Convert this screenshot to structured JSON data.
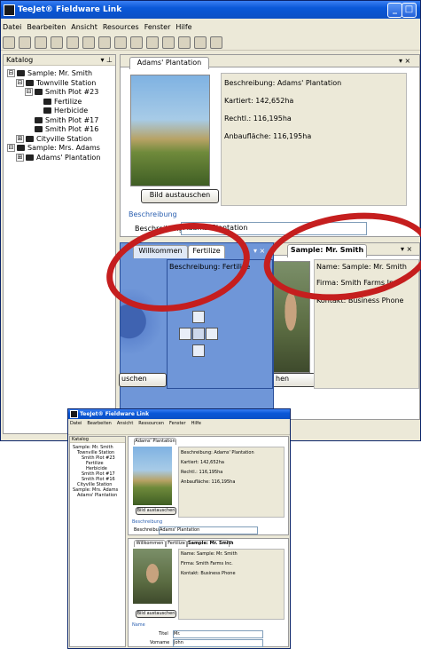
{
  "window": {
    "title": "TeeJet® Fieldware Link",
    "controls": [
      "_",
      "□",
      "×"
    ]
  },
  "menu": [
    "Datei",
    "Bearbeiten",
    "Ansicht",
    "Resources",
    "Fenster",
    "Hilfe"
  ],
  "catalog": {
    "title": "Katalog",
    "pin": "▾ ⊥",
    "items": [
      {
        "label": "Sample: Mr. Smith",
        "level": 0,
        "icon": "person-icon",
        "expander": "⊟"
      },
      {
        "label": "Townville Station",
        "level": 1,
        "icon": "station-icon",
        "expander": "⊟"
      },
      {
        "label": "Smith Plot #23",
        "level": 2,
        "icon": "field-icon",
        "expander": "⊟"
      },
      {
        "label": "Fertilize",
        "level": 3,
        "icon": "task-icon",
        "expander": ""
      },
      {
        "label": "Herbicide",
        "level": 3,
        "icon": "task-icon",
        "expander": ""
      },
      {
        "label": "Smith Plot #17",
        "level": 2,
        "icon": "field-icon",
        "expander": ""
      },
      {
        "label": "Smith Plot #16",
        "level": 2,
        "icon": "field-icon",
        "expander": ""
      },
      {
        "label": "Cityville Station",
        "level": 1,
        "icon": "station-icon",
        "expander": "⊞"
      },
      {
        "label": "Sample: Mrs. Adams",
        "level": 0,
        "icon": "person-icon",
        "expander": "⊟"
      },
      {
        "label": "Adams' Plantation",
        "level": 1,
        "icon": "station-icon",
        "expander": "⊞"
      }
    ]
  },
  "top_doc": {
    "tab": "Adams' Plantation",
    "close": "▾ ×",
    "details": [
      "Beschreibung: Adams' Plantation",
      "Kartiert: 142,652ha",
      "Rechtl.: 116,195ha",
      "Anbaufläche: 116,195ha"
    ],
    "replace_button": "Bild austauschen",
    "section": "Beschreibung",
    "field_label": "Beschreibung",
    "field_value": "Adams' Plantation"
  },
  "bottom_left": {
    "tabs": [
      "Willkommen",
      "Fertilize"
    ],
    "close": "▾ ×",
    "details": [
      "Beschreibung: Fertilize"
    ],
    "button": "uschen"
  },
  "bottom_right": {
    "tab": "Sample: Mr. Smith",
    "close": "▾ ×",
    "details": [
      "Name: Sample: Mr. Smith",
      "Firma: Smith Farms Inc.",
      "Kontakt: Business Phone"
    ],
    "button": "hen"
  },
  "inset": {
    "title": "TeeJet® Fieldware Link",
    "menu": [
      "Datei",
      "Bearbeiten",
      "Ansicht",
      "Ressourcen",
      "Fenster",
      "Hilfe"
    ],
    "catalog_title": "Katalog",
    "tree": [
      "Sample: Mr. Smith",
      "Townville Station",
      "Smith Plot #23",
      "Fertilize",
      "Herbicide",
      "Smith Plot #17",
      "Smith Plot #16",
      "Cityville Station",
      "Sample: Mrs. Adams",
      "Adams' Plantation"
    ],
    "top_tab": "Adams' Plantation",
    "top_details": [
      "Beschreibung: Adams' Plantation",
      "Kartiert: 142,652ha",
      "Rechtl.: 116,195ha",
      "Anbaufläche: 116,195ha"
    ],
    "top_button": "Bild austauschen",
    "top_section": "Beschreibung",
    "top_field_label": "Beschreibung",
    "top_field_value": "Adams' Plantation",
    "bottom_tabs": [
      "Willkommen",
      "Fertilize",
      "Sample: Mr. Smith"
    ],
    "bottom_details": [
      "Name: Sample: Mr. Smith",
      "Firma: Smith Farms Inc.",
      "Kontakt: Business Phone"
    ],
    "bottom_button": "Bild austauschen",
    "bottom_section": "Name",
    "titel_label": "Titel",
    "titel_value": "Mr.",
    "vorname_label": "Vorname",
    "vorname_value": "John"
  },
  "colors": {
    "accent": "#0a58d8",
    "highlight_circle": "#c51e1e",
    "drag_pane": "#6f96d8"
  }
}
